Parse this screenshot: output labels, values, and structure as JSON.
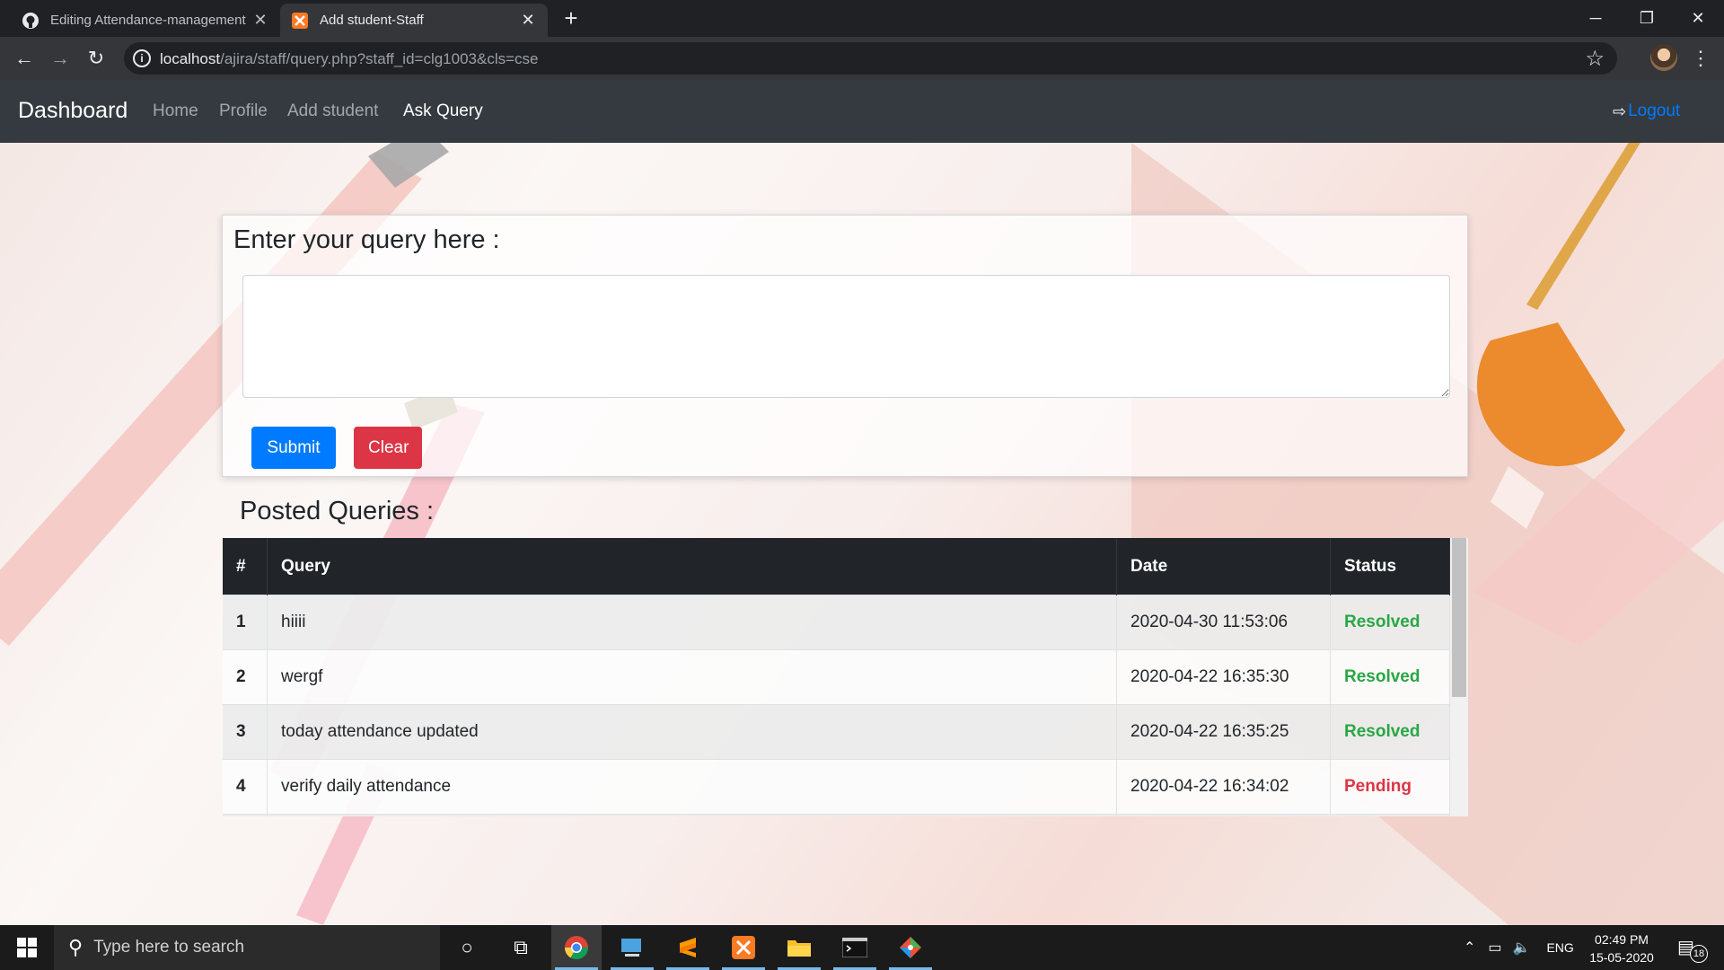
{
  "browser": {
    "tabs": [
      {
        "title": "Editing Attendance-management",
        "icon": "github-icon",
        "active": false
      },
      {
        "title": "Add student-Staff",
        "icon": "xampp-icon",
        "active": true
      }
    ],
    "url_host": "localhost",
    "url_path": "/ajira/staff/query.php?staff_id=clg1003&cls=cse"
  },
  "navbar": {
    "brand": "Dashboard",
    "links": [
      "Home",
      "Profile",
      "Add student",
      "Ask Query"
    ],
    "active_link": "Ask Query",
    "logout": "Logout"
  },
  "query_form": {
    "heading": "Enter your query here :",
    "textarea_value": "",
    "submit_label": "Submit",
    "clear_label": "Clear"
  },
  "posted": {
    "heading": "Posted Queries :",
    "columns": [
      "#",
      "Query",
      "Date",
      "Status"
    ],
    "rows": [
      {
        "num": "1",
        "query": "hiiii",
        "date": "2020-04-30 11:53:06",
        "status": "Resolved"
      },
      {
        "num": "2",
        "query": "wergf",
        "date": "2020-04-22 16:35:30",
        "status": "Resolved"
      },
      {
        "num": "3",
        "query": "today attendance updated",
        "date": "2020-04-22 16:35:25",
        "status": "Resolved"
      },
      {
        "num": "4",
        "query": "verify daily attendance",
        "date": "2020-04-22 16:34:02",
        "status": "Pending"
      }
    ]
  },
  "colors": {
    "resolved": "#28a745",
    "pending": "#dc3545",
    "primary": "#007bff",
    "navbar": "#343a40"
  },
  "taskbar": {
    "search_placeholder": "Type here to search",
    "language": "ENG",
    "time": "02:49 PM",
    "date": "15-05-2020",
    "notification_count": "18"
  }
}
